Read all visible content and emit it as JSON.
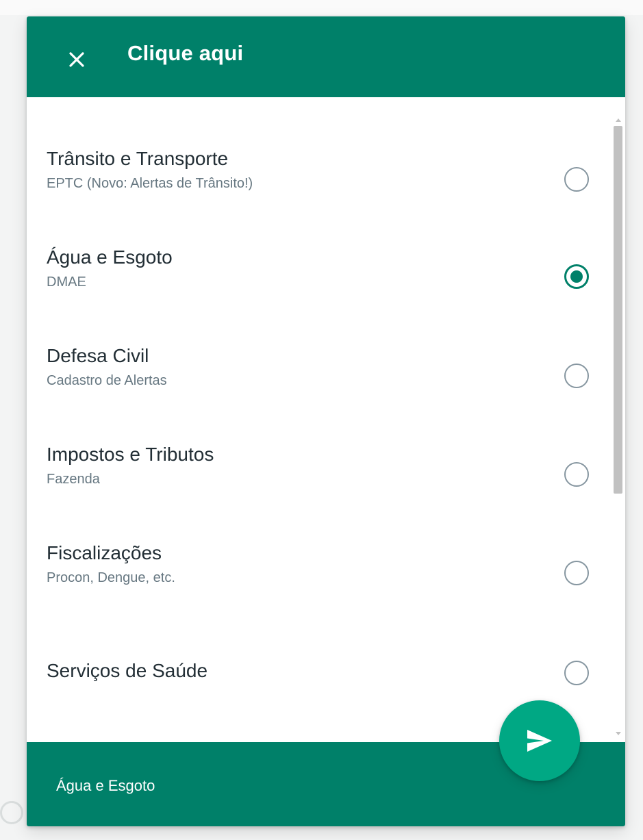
{
  "header": {
    "title": "Clique aqui"
  },
  "options": [
    {
      "title": "Trânsito e Transporte",
      "subtitle": "EPTC (Novo: Alertas de Trânsito!)",
      "selected": false
    },
    {
      "title": "Água e Esgoto",
      "subtitle": "DMAE",
      "selected": true
    },
    {
      "title": "Defesa Civil",
      "subtitle": "Cadastro de Alertas",
      "selected": false
    },
    {
      "title": "Impostos e Tributos",
      "subtitle": "Fazenda",
      "selected": false
    },
    {
      "title": "Fiscalizações",
      "subtitle": "Procon, Dengue, etc.",
      "selected": false
    },
    {
      "title": "Serviços de Saúde",
      "subtitle": "",
      "selected": false
    }
  ],
  "footer": {
    "selected_label": "Água e Esgoto"
  },
  "icons": {
    "close": "close-icon",
    "send": "send-icon"
  },
  "colors": {
    "header_bg": "#008069",
    "footer_bg": "#008069",
    "send_button": "#00a884",
    "radio_checked": "#008069",
    "radio_unchecked": "#8696a0"
  }
}
